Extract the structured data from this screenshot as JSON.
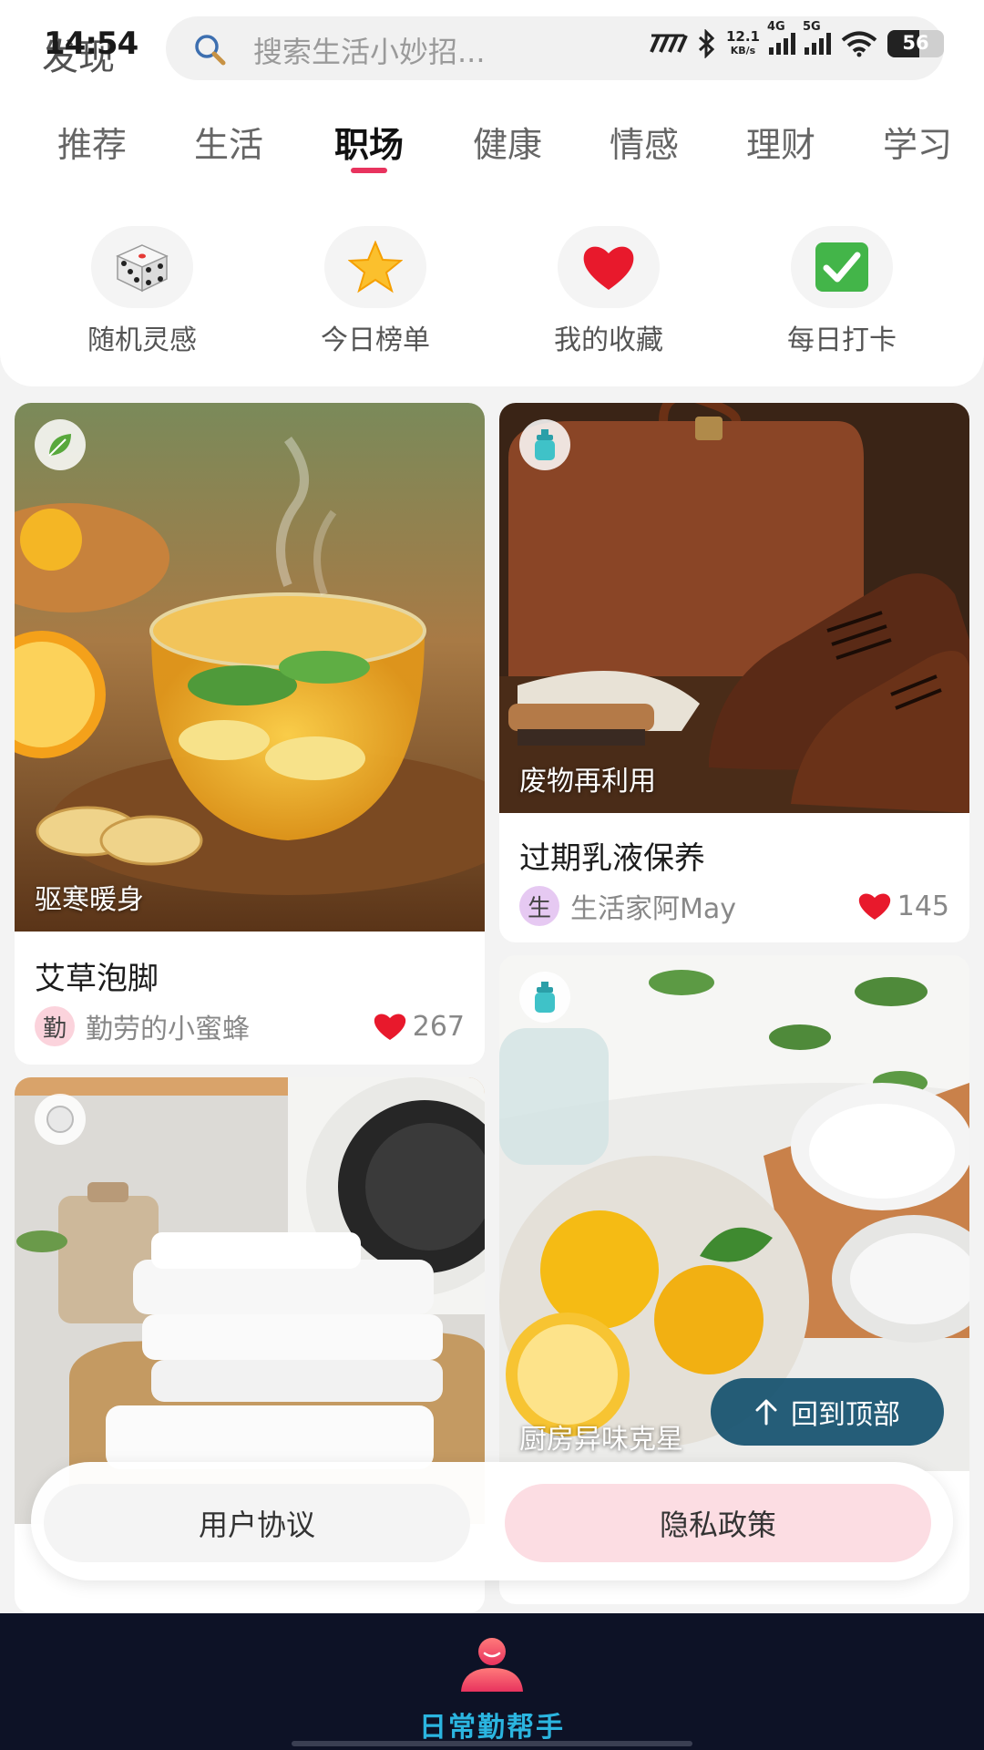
{
  "status_bar": {
    "time": "14:54",
    "page_label": "发现",
    "net_speed_value": "12.1",
    "net_speed_unit": "KB/s",
    "sim1": "4G",
    "sim2": "5G",
    "battery": "56",
    "battery_level_percent": 56
  },
  "search": {
    "placeholder": "搜索生活小妙招..."
  },
  "tabs": [
    {
      "label": "推荐"
    },
    {
      "label": "生活"
    },
    {
      "label": "职场",
      "active": true
    },
    {
      "label": "健康"
    },
    {
      "label": "情感"
    },
    {
      "label": "理财"
    },
    {
      "label": "学习"
    }
  ],
  "quick_entries": [
    {
      "label": "随机灵感",
      "icon": "dice-icon"
    },
    {
      "label": "今日榜单",
      "icon": "star-icon"
    },
    {
      "label": "我的收藏",
      "icon": "heart-icon"
    },
    {
      "label": "每日打卡",
      "icon": "check-icon"
    }
  ],
  "feed": [
    {
      "tagline": "驱寒暖身",
      "badge": "leaf-icon",
      "title": "艾草泡脚",
      "avatar": "勤",
      "author": "勤劳的小蜜蜂",
      "likes": "267"
    },
    {
      "tagline": "废物再利用",
      "badge": "bottle-icon",
      "title": "过期乳液保养",
      "avatar": "生",
      "author": "生活家阿May",
      "likes": "145"
    },
    {
      "tagline": "",
      "badge": "dot-icon",
      "title": "",
      "avatar": "",
      "author": "",
      "likes": ""
    },
    {
      "tagline": "厨房异味克星",
      "badge": "bottle-icon",
      "title": "",
      "avatar": "",
      "author": "",
      "likes": ""
    }
  ],
  "back_to_top": "回到顶部",
  "policy": {
    "user_agreement": "用户协议",
    "privacy_policy": "隐私政策"
  },
  "app_name": "日常勤帮手",
  "colors": {
    "accent": "#e8335e",
    "brand": "#2bb5e0",
    "bottom_bar": "#0d1226",
    "back_to_top": "#14506e"
  }
}
